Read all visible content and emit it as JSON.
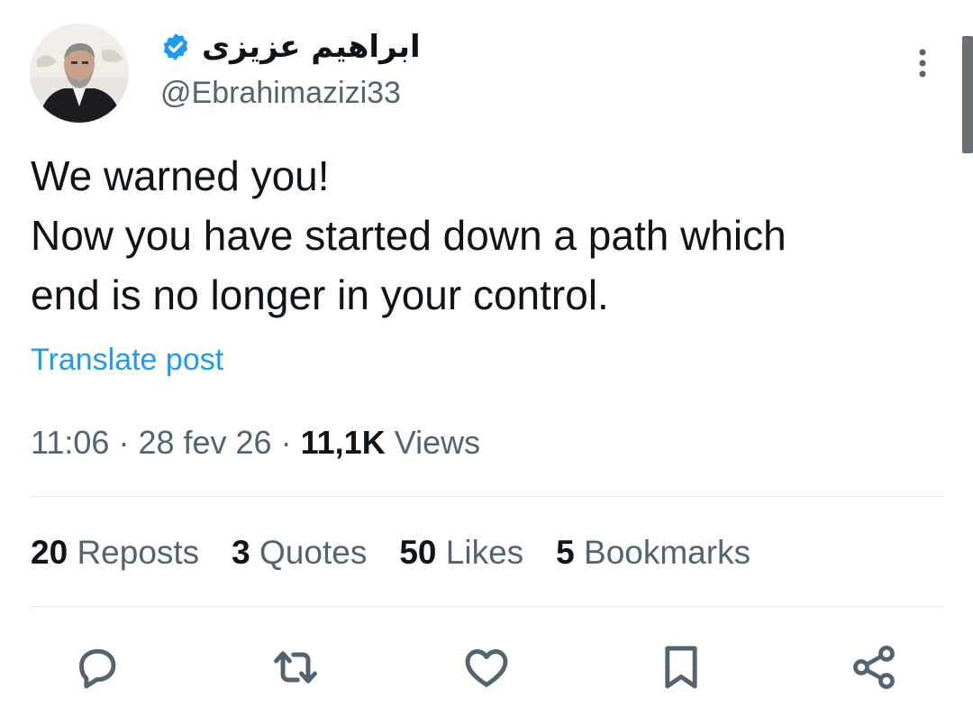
{
  "user": {
    "display_name": "ابراهیم عزیزی",
    "handle": "@Ebrahimazizi33",
    "verified_color": "#1d9bf0"
  },
  "tweet": {
    "lines": [
      "We warned you!",
      "Now you have started down a path which",
      "end is no longer in your control."
    ],
    "translate_label": "Translate post",
    "time": "11:06",
    "date": "28 fev 26",
    "separator": "·",
    "views_count": "11,1K",
    "views_label": "Views"
  },
  "stats": [
    {
      "count": "20",
      "label": "Reposts"
    },
    {
      "count": "3",
      "label": "Quotes"
    },
    {
      "count": "50",
      "label": "Likes"
    },
    {
      "count": "5",
      "label": "Bookmarks"
    }
  ],
  "actions": [
    "reply-icon",
    "repost-icon",
    "like-icon",
    "bookmark-icon",
    "share-icon"
  ],
  "colors": {
    "text": "#0f1419",
    "secondary": "#536471",
    "link": "#1d9bf0",
    "divider": "#e3e6e9"
  }
}
